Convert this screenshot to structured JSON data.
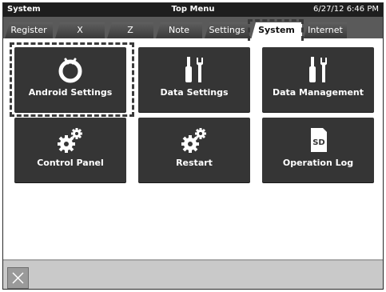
{
  "titlebar": {
    "left": "System",
    "center": "Top Menu",
    "datetime": "6/27/12 6:46 PM"
  },
  "tabs": [
    {
      "label": "Register"
    },
    {
      "label": "X"
    },
    {
      "label": "Z"
    },
    {
      "label": "Note"
    },
    {
      "label": "Settings"
    },
    {
      "label": "System",
      "active": true
    },
    {
      "label": "Internet"
    }
  ],
  "menu": [
    {
      "label": "Android Settings",
      "icon": "android-settings-icon",
      "highlighted": true
    },
    {
      "label": "Data Settings",
      "icon": "tools-icon"
    },
    {
      "label": "Data Management",
      "icon": "tools-icon"
    },
    {
      "label": "Control Panel",
      "icon": "gears-icon"
    },
    {
      "label": "Restart",
      "icon": "gears-icon"
    },
    {
      "label": "Operation Log",
      "icon": "sd-card-icon",
      "icon_text": "SD"
    }
  ],
  "bottombar": {
    "close_icon": "close-icon"
  },
  "colors": {
    "titlebar_bg": "#1e1e1e",
    "tabstrip_bg": "#5a5a5a",
    "tile_bg": "#353535",
    "bottombar_bg": "#c9c9c9"
  }
}
